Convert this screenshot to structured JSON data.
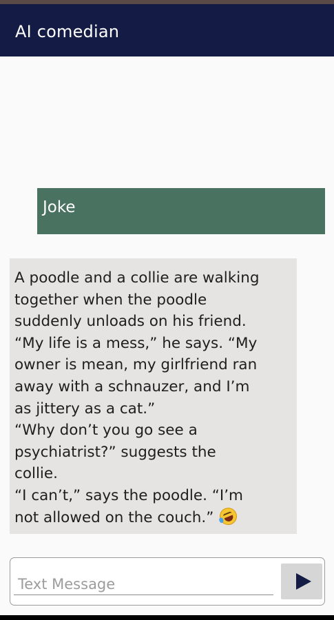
{
  "app": {
    "title": "AI comedian"
  },
  "messages": {
    "user": {
      "text": "Joke"
    },
    "bot": {
      "lines": [
        "A poodle and a collie are walking",
        "together when the poodle",
        "suddenly unloads on his friend.",
        "“My life is a mess,” he says. “My",
        "owner is mean, my girlfriend ran",
        "away with a schnauzer, and I’m",
        "as jittery as a cat.”",
        "“Why don’t you go see a",
        "psychiatrist?” suggests the",
        "collie.",
        "“I can’t,” says the poodle. “I’m",
        "not allowed on the couch.”"
      ],
      "emoji": "rolling-on-floor-laughing-icon"
    }
  },
  "composer": {
    "placeholder": "Text Message",
    "value": "",
    "send_icon": "send-arrow-icon"
  },
  "colors": {
    "app_bar": "#141c45",
    "user_bubble": "#4a7260",
    "bot_bubble": "#e6e3e3",
    "send_button": "#d6d6d6"
  }
}
